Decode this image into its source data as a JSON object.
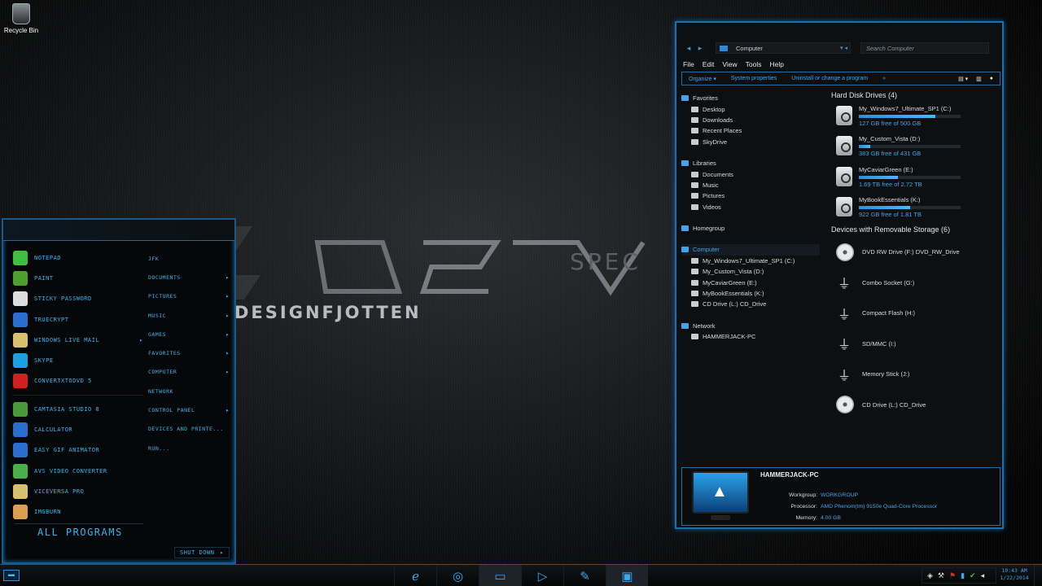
{
  "desktop": {
    "recycle_bin_label": "Recycle Bin"
  },
  "wallpaper": {
    "brand_text": "DESIGNFJOTTEN",
    "spec_text": "SPEC"
  },
  "start_menu": {
    "pinned": [
      {
        "label": "NOTEPAD",
        "icon": "notepad-icon",
        "color": "#3fbf3f"
      },
      {
        "label": "PAINT",
        "icon": "paint-icon",
        "color": "#4f9f2f"
      },
      {
        "label": "STICKY PASSWORD",
        "icon": "sticky-password-icon",
        "color": "#dddddd"
      },
      {
        "label": "TRUECRYPT",
        "icon": "truecrypt-icon",
        "color": "#2a6fd0"
      },
      {
        "label": "WINDOWS LIVE MAIL",
        "icon": "mail-icon",
        "color": "#d8c070",
        "arrow": "▸"
      },
      {
        "label": "SKYPE",
        "icon": "skype-icon",
        "color": "#1aa1e0"
      },
      {
        "label": "CONVERTXTODVD 5",
        "icon": "convertxtodvd-icon",
        "color": "#d02020"
      }
    ],
    "recent": [
      {
        "label": "CAMTASIA STUDIO 8",
        "icon": "camtasia-icon",
        "color": "#4a9a3a"
      },
      {
        "label": "CALCULATOR",
        "icon": "calculator-icon",
        "color": "#2a6fd0"
      },
      {
        "label": "EASY GIF ANIMATOR",
        "icon": "gif-animator-icon",
        "color": "#2a6fd0"
      },
      {
        "label": "AVS VIDEO CONVERTER",
        "icon": "avs-icon",
        "color": "#4ab04a"
      },
      {
        "label": "VICEVERSA PRO",
        "icon": "viceversa-icon",
        "color": "#d8c070"
      },
      {
        "label": "IMGBURN",
        "icon": "imgburn-icon",
        "color": "#d8a050"
      }
    ],
    "all_programs": "ALL PROGRAMS",
    "right_items": [
      {
        "label": "JFK",
        "arrow": ""
      },
      {
        "label": "DOCUMENTS",
        "arrow": "▸"
      },
      {
        "label": "PICTURES",
        "arrow": "▸"
      },
      {
        "label": "MUSIC",
        "arrow": "▸"
      },
      {
        "label": "GAMES",
        "arrow": "▸"
      },
      {
        "label": "FAVORITES",
        "arrow": "▸"
      },
      {
        "label": "COMPUTER",
        "arrow": "▸"
      },
      {
        "label": "NETWORK",
        "arrow": ""
      },
      {
        "label": "CONTROL PANEL",
        "arrow": "▸"
      },
      {
        "label": "DEVICES AND PRINTE...",
        "arrow": ""
      },
      {
        "label": "RUN...",
        "arrow": ""
      }
    ],
    "shutdown": "SHUT DOWN",
    "shutdown_arrow": "▸"
  },
  "explorer": {
    "address": "Computer",
    "search_placeholder": "Search Computer",
    "menu": [
      "File",
      "Edit",
      "View",
      "Tools",
      "Help"
    ],
    "commands": [
      "Organize ▾",
      "System properties",
      "Uninstall or change a program",
      "»"
    ],
    "tree": {
      "favorites": [
        "Favorites",
        "Desktop",
        "Downloads",
        "Recent Places",
        "SkyDrive"
      ],
      "libraries": [
        "Libraries",
        "Documents",
        "Music",
        "Pictures",
        "Videos"
      ],
      "homegroup": [
        "Homegroup"
      ],
      "computer": [
        "Computer",
        "My_Windows7_Ultimate_SP1 (C:)",
        "My_Custom_Vista (D:)",
        "MyCaviarGreen (E:)",
        "MyBookEssentials (K:)",
        "CD Drive (L:) CD_Drive"
      ],
      "network": [
        "Network",
        "HAMMERJACK-PC"
      ]
    },
    "hdd_title": "Hard Disk Drives (4)",
    "drives": [
      {
        "name": "My_Windows7_Ultimate_SP1 (C:)",
        "free": "127 GB free of 500 GB",
        "used_fraction": 0.75
      },
      {
        "name": "My_Custom_Vista (D:)",
        "free": "383 GB free of 431 GB",
        "used_fraction": 0.11
      },
      {
        "name": "MyCaviarGreen (E:)",
        "free": "1.69 TB free of 2.72 TB",
        "used_fraction": 0.38
      },
      {
        "name": "MyBookEssentials (K:)",
        "free": "922 GB free of 1.81 TB",
        "used_fraction": 0.5
      }
    ],
    "removable_title": "Devices with Removable Storage (6)",
    "removable": [
      {
        "name": "DVD RW Drive (F:) DVD_RW_Drive",
        "kind": "disc"
      },
      {
        "name": "Combo Socket (G:)",
        "kind": "usb"
      },
      {
        "name": "Compact Flash (H:)",
        "kind": "usb"
      },
      {
        "name": "SD/MMC (I:)",
        "kind": "usb"
      },
      {
        "name": "Memory Stick (J:)",
        "kind": "usb"
      },
      {
        "name": "CD Drive (L:) CD_Drive",
        "kind": "disc"
      }
    ],
    "details": {
      "pc_name": "HAMMERJACK-PC",
      "workgroup_label": "Workgroup:",
      "workgroup": "WORKGROUP",
      "processor_label": "Processor:",
      "processor": "AMD Phenom(tm) 9150e Quad-Core Processor",
      "memory_label": "Memory:",
      "memory": "4.00 GB"
    }
  },
  "taskbar": {
    "clock_time": "10:43 AM",
    "clock_date": "1/22/2014"
  }
}
